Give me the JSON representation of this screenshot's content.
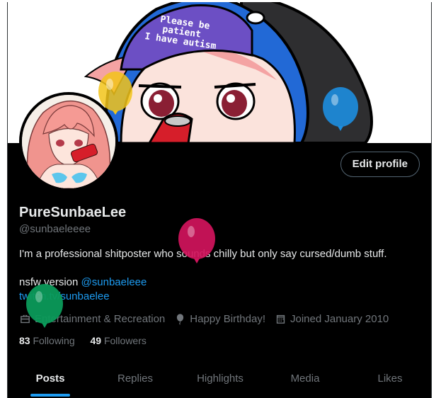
{
  "banner": {
    "hat_text": [
      "Please be",
      "patient",
      "I have autism"
    ]
  },
  "profile": {
    "edit_button": "Edit profile",
    "display_name": "PureSunbaeLee",
    "handle": "@sunbaeleeee",
    "bio_line1": "I'm a professional shitposter who sounds chilly but only say cursed/dumb stuff.",
    "bio_line2_prefix": "nsfw version ",
    "bio_line2_link": "@sunbaeleee",
    "bio_line3_link": "twitch.tv/sunbaelee",
    "category": "Entertainment & Recreation",
    "birthday": "Happy Birthday!",
    "joined": "Joined January 2010",
    "following_count": "83",
    "following_label": "Following",
    "followers_count": "49",
    "followers_label": "Followers"
  },
  "tabs": [
    {
      "label": "Posts",
      "active": true
    },
    {
      "label": "Replies",
      "active": false
    },
    {
      "label": "Highlights",
      "active": false
    },
    {
      "label": "Media",
      "active": false
    },
    {
      "label": "Likes",
      "active": false
    }
  ],
  "colors": {
    "accent": "#1d9bf0",
    "background": "#000000",
    "text_primary": "#e7e9ea",
    "text_secondary": "#71767b",
    "balloon_yellow": "#f2c41a",
    "balloon_blue": "#1d8ee0",
    "balloon_magenta": "#d1145c",
    "balloon_green": "#0b9a5a"
  },
  "icons": {
    "category": "briefcase-icon",
    "birthday": "balloon-icon",
    "joined": "calendar-icon"
  }
}
